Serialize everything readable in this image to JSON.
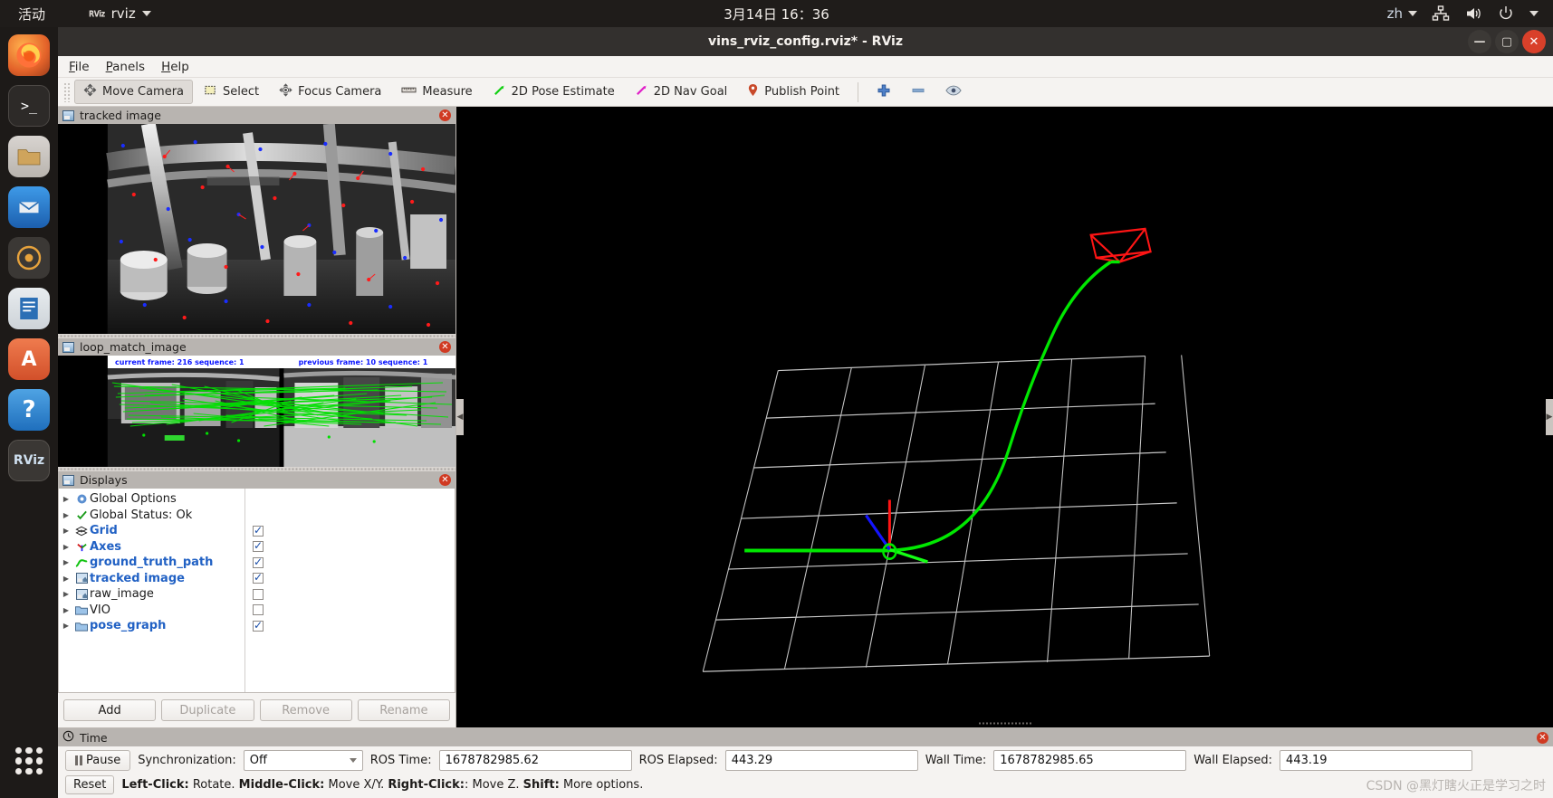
{
  "topbar": {
    "activities": "活动",
    "app_badge": "RViz",
    "app_name": "rviz",
    "clock": "3月14日  16：36",
    "language": "zh",
    "icons": [
      "network-icon",
      "volume-icon",
      "power-icon",
      "chevron-down-icon"
    ]
  },
  "window": {
    "title": "vins_rviz_config.rviz* - RViz",
    "minimize": "—",
    "maximize": "▢",
    "close": "✕"
  },
  "menubar": {
    "items": [
      "File",
      "Panels",
      "Help"
    ]
  },
  "toolbar": {
    "buttons": [
      {
        "label": "Move Camera",
        "icon": "move-camera-icon",
        "active": true
      },
      {
        "label": "Select",
        "icon": "select-icon",
        "active": false
      },
      {
        "label": "Focus Camera",
        "icon": "focus-camera-icon",
        "active": false
      },
      {
        "label": "Measure",
        "icon": "measure-ruler-icon",
        "active": false
      },
      {
        "label": "2D Pose Estimate",
        "icon": "pose-estimate-arrow-icon",
        "active": false
      },
      {
        "label": "2D Nav Goal",
        "icon": "nav-goal-arrow-icon",
        "active": false
      },
      {
        "label": "Publish Point",
        "icon": "publish-point-pin-icon",
        "active": false
      }
    ],
    "extra_icons": [
      "plus-icon",
      "minus-icon",
      "eye-icon"
    ]
  },
  "panels": {
    "tracked_image": {
      "title": "tracked image",
      "close": "✕"
    },
    "loop_match_image": {
      "title": "loop_match_image",
      "close": "✕",
      "overlay_left": "current frame: 216   sequence: 1",
      "overlay_right": "previous frame: 10   sequence: 1"
    },
    "displays": {
      "title": "Displays",
      "close": "✕",
      "items": [
        {
          "label": "Global Options",
          "icon": "gear-icon",
          "blue": false,
          "checkbox": null
        },
        {
          "label": "Global Status: Ok",
          "icon": "check-icon",
          "blue": false,
          "checkbox": null
        },
        {
          "label": "Grid",
          "icon": "grid-icon",
          "blue": true,
          "checkbox": true
        },
        {
          "label": "Axes",
          "icon": "axes-icon",
          "blue": true,
          "checkbox": true
        },
        {
          "label": "ground_truth_path",
          "icon": "path-icon",
          "blue": true,
          "checkbox": true
        },
        {
          "label": "tracked image",
          "icon": "image-icon",
          "blue": true,
          "checkbox": true
        },
        {
          "label": "raw_image",
          "icon": "image-icon",
          "blue": false,
          "checkbox": false
        },
        {
          "label": "VIO",
          "icon": "folder-icon",
          "blue": false,
          "checkbox": false
        },
        {
          "label": "pose_graph",
          "icon": "folder-icon",
          "blue": true,
          "checkbox": true
        }
      ],
      "buttons": [
        {
          "label": "Add",
          "enabled": true
        },
        {
          "label": "Duplicate",
          "enabled": false
        },
        {
          "label": "Remove",
          "enabled": false
        },
        {
          "label": "Rename",
          "enabled": false
        }
      ]
    }
  },
  "time_panel": {
    "title": "Time",
    "close": "✕",
    "pause_label": "Pause",
    "sync_label": "Synchronization:",
    "sync_value": "Off",
    "ros_time_label": "ROS Time:",
    "ros_time_value": "1678782985.62",
    "ros_elapsed_label": "ROS Elapsed:",
    "ros_elapsed_value": "443.29",
    "wall_time_label": "Wall Time:",
    "wall_time_value": "1678782985.65",
    "wall_elapsed_label": "Wall Elapsed:",
    "wall_elapsed_value": "443.19",
    "reset_label": "Reset",
    "hint": [
      {
        "bold": "Left-Click:",
        "text": " Rotate. "
      },
      {
        "bold": "Middle-Click:",
        "text": " Move X/Y. "
      },
      {
        "bold": "Right-Click:",
        "text": ": Move Z. "
      },
      {
        "bold": "Shift:",
        "text": " More options."
      }
    ],
    "hint_plain": "Left-Click: Rotate. Middle-Click: Move X/Y. Right-Click:: Move Z. Shift: More options."
  },
  "dock": {
    "items": [
      {
        "name": "firefox-icon",
        "color": "#e4632a",
        "glyph": "🦊"
      },
      {
        "name": "terminal-icon",
        "color": "#2d2a28",
        "glyph": ">_"
      },
      {
        "name": "files-icon",
        "color": "#c5883c",
        "glyph": "🗀"
      },
      {
        "name": "thunderbird-icon",
        "color": "#2a7fd4",
        "glyph": "✉"
      },
      {
        "name": "rhythmbox-icon",
        "color": "#3b3835",
        "glyph": "◉"
      },
      {
        "name": "libreoffice-writer-icon",
        "color": "#2b6fb5",
        "glyph": "▤"
      },
      {
        "name": "ubuntu-software-icon",
        "color": "#e2633c",
        "glyph": "A"
      },
      {
        "name": "help-icon",
        "color": "#2f7fc9",
        "glyph": "?"
      },
      {
        "name": "rviz-icon",
        "color": "#3c3936",
        "glyph": "RViz"
      }
    ],
    "show_apps": "show-applications-icon"
  },
  "viewport": {
    "watermark": "CSDN @黑灯瞎火正是学习之时",
    "colors": {
      "background": "#000000",
      "grid": "#d8d8d8",
      "trajectory": "#00e000",
      "axis_x": "#ff2020",
      "axis_y": "#20ff20",
      "axis_z": "#2020ff",
      "camera_marker": "#ff1515"
    }
  }
}
